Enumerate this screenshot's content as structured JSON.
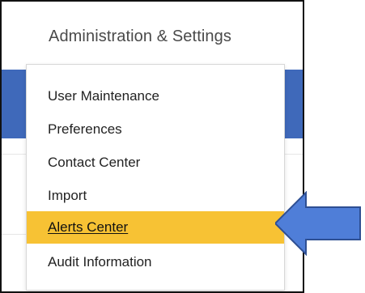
{
  "header": {
    "title": "Administration & Settings"
  },
  "menu": {
    "items": [
      {
        "label": "User Maintenance"
      },
      {
        "label": "Preferences"
      },
      {
        "label": "Contact Center"
      },
      {
        "label": "Import"
      },
      {
        "label": "Alerts Center",
        "active": true
      },
      {
        "label": "Audit Information"
      }
    ]
  },
  "colors": {
    "accent": "#3f69ba",
    "highlight": "#f7c234"
  },
  "icons": {
    "pointer": "right-arrow-icon"
  }
}
